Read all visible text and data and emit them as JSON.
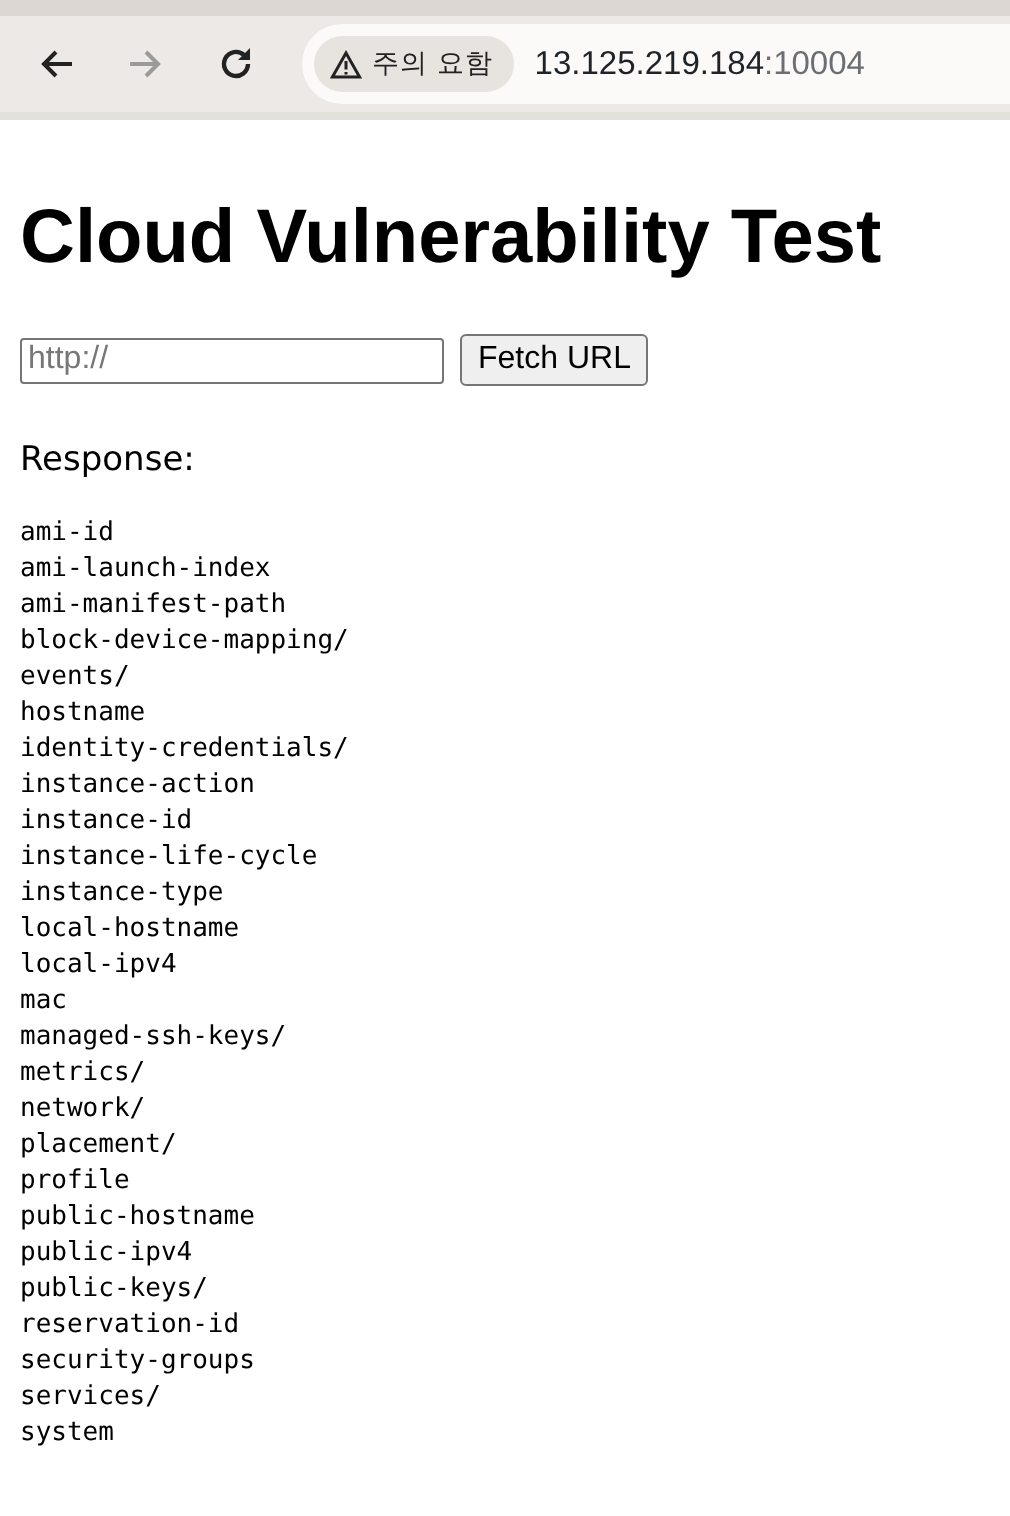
{
  "browser": {
    "warning": "주의 요함",
    "url_host": "13.125.219.184",
    "url_port": ":10004",
    "forward_disabled": true
  },
  "heading": "Cloud Vulnerability Test",
  "url_field": {
    "placeholder": "http://"
  },
  "fetch_button": "Fetch URL",
  "response_label": "Response:",
  "response_lines": [
    "ami-id",
    "ami-launch-index",
    "ami-manifest-path",
    "block-device-mapping/",
    "events/",
    "hostname",
    "identity-credentials/",
    "instance-action",
    "instance-id",
    "instance-life-cycle",
    "instance-type",
    "local-hostname",
    "local-ipv4",
    "mac",
    "managed-ssh-keys/",
    "metrics/",
    "network/",
    "placement/",
    "profile",
    "public-hostname",
    "public-ipv4",
    "public-keys/",
    "reservation-id",
    "security-groups",
    "services/",
    "system"
  ]
}
